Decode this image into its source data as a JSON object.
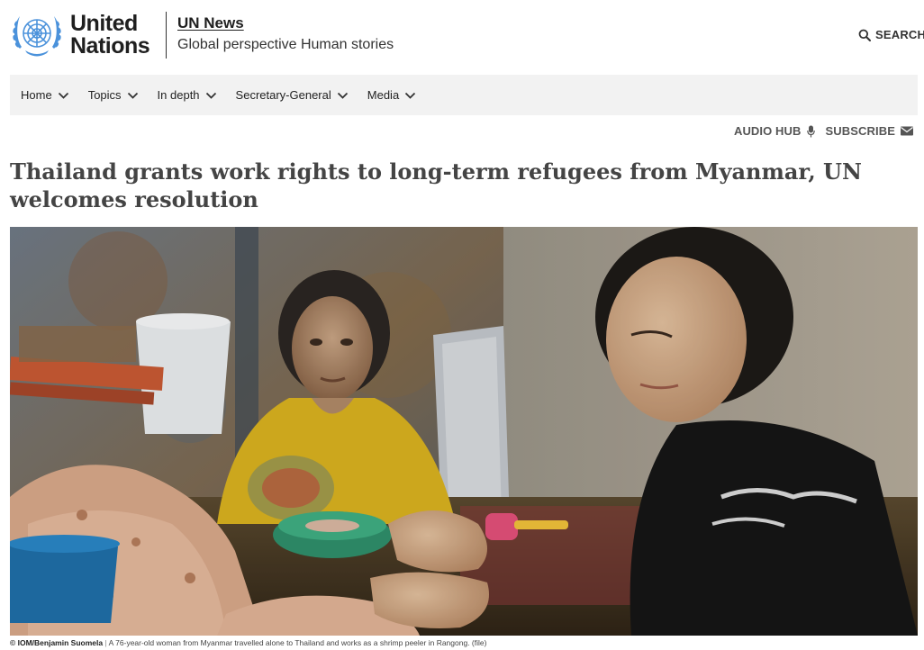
{
  "logo": {
    "line1": "United",
    "line2": "Nations"
  },
  "site": {
    "name": "UN News",
    "tagline": "Global perspective Human stories"
  },
  "search": {
    "label": "SEARCH",
    "icon": "search-icon"
  },
  "nav": {
    "items": [
      {
        "label": "Home"
      },
      {
        "label": "Topics"
      },
      {
        "label": "In depth"
      },
      {
        "label": "Secretary-General"
      },
      {
        "label": "Media"
      }
    ]
  },
  "utility": {
    "audio_hub": "AUDIO HUB",
    "subscribe": "SUBSCRIBE"
  },
  "article": {
    "headline": "Thailand grants work rights to long-term refugees from Myanmar, UN welcomes resolution",
    "image_credit": "© IOM/Benjamin Suomela",
    "caption_separator": "|",
    "image_caption": "A 76-year-old woman from Myanmar travelled alone to Thailand and works as a shrimp peeler in Rangong. (file)"
  },
  "colors": {
    "un_blue": "#4b92db",
    "nav_bg": "#f2f2f2",
    "headline": "#444444"
  }
}
